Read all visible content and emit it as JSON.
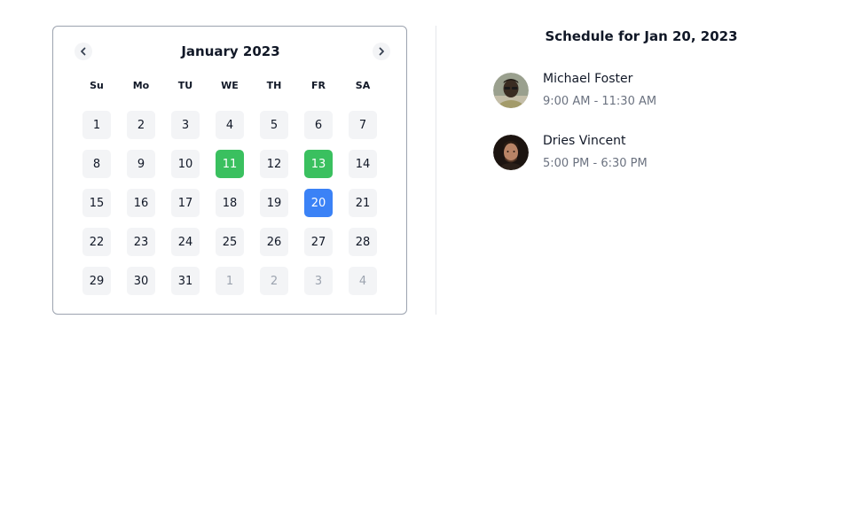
{
  "calendar": {
    "month_label": "January 2023",
    "prev_icon": "chevron-left-icon",
    "next_icon": "chevron-right-icon",
    "weekdays": [
      "Su",
      "Mo",
      "TU",
      "WE",
      "TH",
      "FR",
      "SA"
    ],
    "days": [
      {
        "label": "1",
        "state": "normal"
      },
      {
        "label": "2",
        "state": "normal"
      },
      {
        "label": "3",
        "state": "normal"
      },
      {
        "label": "4",
        "state": "normal"
      },
      {
        "label": "5",
        "state": "normal"
      },
      {
        "label": "6",
        "state": "normal"
      },
      {
        "label": "7",
        "state": "normal"
      },
      {
        "label": "8",
        "state": "normal"
      },
      {
        "label": "9",
        "state": "normal"
      },
      {
        "label": "10",
        "state": "normal"
      },
      {
        "label": "11",
        "state": "event"
      },
      {
        "label": "12",
        "state": "normal"
      },
      {
        "label": "13",
        "state": "event"
      },
      {
        "label": "14",
        "state": "normal"
      },
      {
        "label": "15",
        "state": "normal"
      },
      {
        "label": "16",
        "state": "normal"
      },
      {
        "label": "17",
        "state": "normal"
      },
      {
        "label": "18",
        "state": "normal"
      },
      {
        "label": "19",
        "state": "normal"
      },
      {
        "label": "20",
        "state": "selected"
      },
      {
        "label": "21",
        "state": "normal"
      },
      {
        "label": "22",
        "state": "normal"
      },
      {
        "label": "23",
        "state": "normal"
      },
      {
        "label": "24",
        "state": "normal"
      },
      {
        "label": "25",
        "state": "normal"
      },
      {
        "label": "26",
        "state": "normal"
      },
      {
        "label": "27",
        "state": "normal"
      },
      {
        "label": "28",
        "state": "normal"
      },
      {
        "label": "29",
        "state": "normal"
      },
      {
        "label": "30",
        "state": "normal"
      },
      {
        "label": "31",
        "state": "normal"
      },
      {
        "label": "1",
        "state": "outside"
      },
      {
        "label": "2",
        "state": "outside"
      },
      {
        "label": "3",
        "state": "outside"
      },
      {
        "label": "4",
        "state": "outside"
      }
    ]
  },
  "schedule": {
    "title": "Schedule for Jan 20, 2023",
    "events": [
      {
        "name": "Michael Foster",
        "time": "9:00 AM - 11:30 AM",
        "avatar": "avatar-photo"
      },
      {
        "name": "Dries Vincent",
        "time": "5:00 PM - 6:30 PM",
        "avatar": "avatar-photo"
      }
    ]
  },
  "colors": {
    "event_day": "#3ac05f",
    "selected_day": "#3b82f6",
    "day_bg": "#f3f4f6",
    "muted_text": "#9ca3af",
    "secondary_text": "#6b7280"
  }
}
